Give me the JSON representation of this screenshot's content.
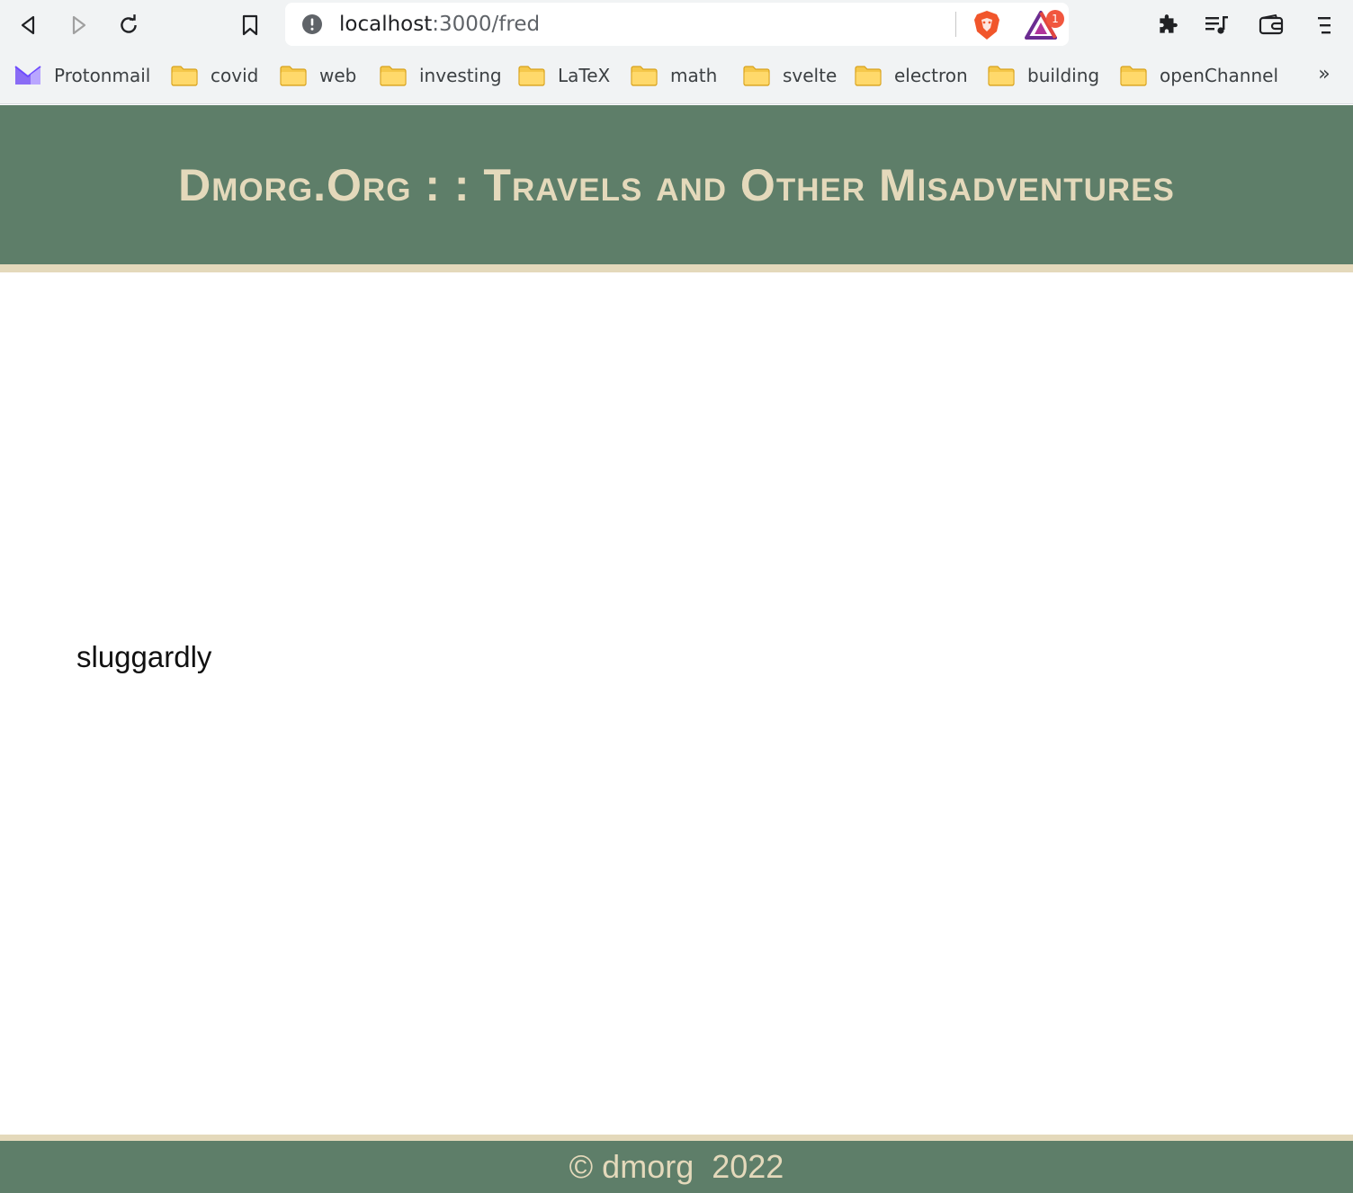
{
  "browser": {
    "url_host": "localhost",
    "url_path": ":3000/fred",
    "rewards_badge": "1",
    "bookmarks": [
      {
        "label": "Protonmail",
        "icon": "protonmail-icon"
      },
      {
        "label": "covid",
        "icon": "folder-icon"
      },
      {
        "label": "web",
        "icon": "folder-icon"
      },
      {
        "label": "investing",
        "icon": "folder-icon"
      },
      {
        "label": "LaTeX",
        "icon": "folder-icon"
      },
      {
        "label": "math",
        "icon": "folder-icon"
      },
      {
        "label": "svelte",
        "icon": "folder-icon"
      },
      {
        "label": "electron",
        "icon": "folder-icon"
      },
      {
        "label": "building",
        "icon": "folder-icon"
      },
      {
        "label": "openChannel",
        "icon": "folder-icon"
      }
    ],
    "more_bookmarks": "»"
  },
  "page": {
    "title": "Dmorg.Org : : Travels and Other Misadventures",
    "content_text": "sluggardly",
    "footer_text": "© dmorg  2022"
  },
  "colors": {
    "header_bg": "#5e7e69",
    "accent": "#e4d9bb"
  }
}
